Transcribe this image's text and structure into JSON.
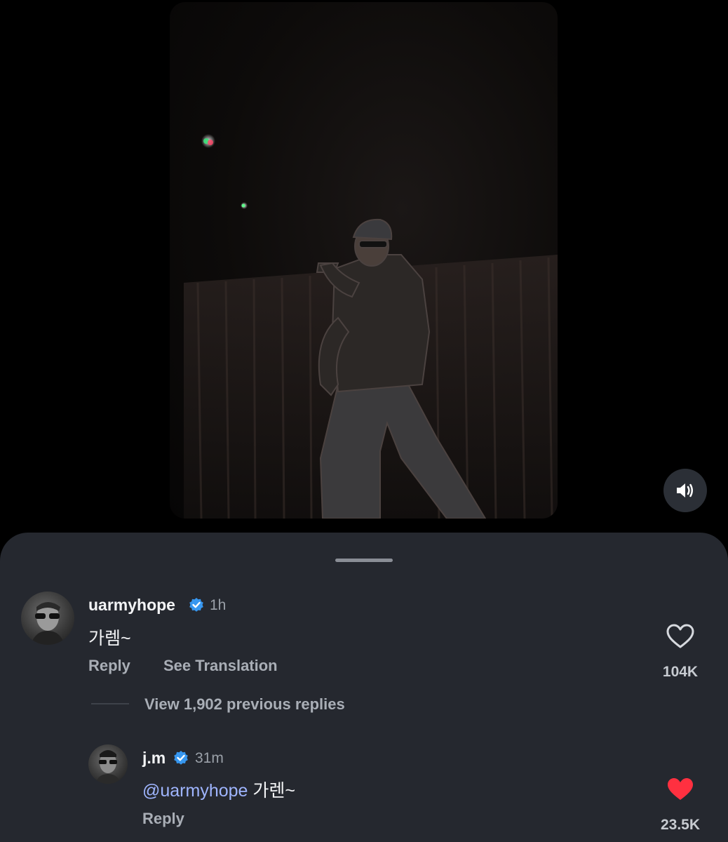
{
  "video": {
    "sound_icon": "speaker-icon"
  },
  "comments": [
    {
      "username": "uarmyhope",
      "verified": true,
      "time": "1h",
      "text": "가렘~",
      "reply_label": "Reply",
      "translate_label": "See Translation",
      "like_count": "104K",
      "liked": false
    }
  ],
  "view_replies_label": "View 1,902 previous replies",
  "reply": {
    "username": "j.m",
    "verified": true,
    "time": "31m",
    "mention": "@uarmyhope",
    "text": " 가렌~",
    "reply_label": "Reply",
    "like_count": "23.5K",
    "liked": true
  },
  "colors": {
    "sheet_bg": "#25282f",
    "verified_blue": "#3797f0",
    "mention": "#9fb5ff",
    "like_red": "#ff3040"
  }
}
